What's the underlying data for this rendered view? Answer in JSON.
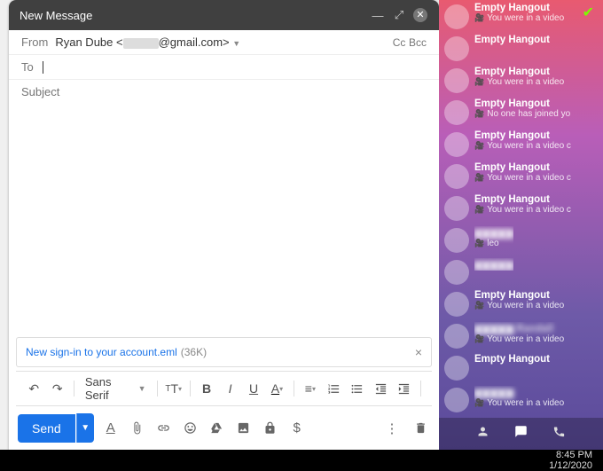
{
  "compose": {
    "title": "New Message",
    "from_label": "From",
    "from_name": "Ryan Dube <",
    "from_domain": "@gmail.com>",
    "cc": "Cc",
    "bcc": "Bcc",
    "to_label": "To",
    "subject_placeholder": "Subject",
    "attachment": {
      "name": "New sign-in to your account.eml",
      "size": "(36K)"
    },
    "font": "Sans Serif",
    "send": "Send"
  },
  "hangouts": {
    "items": [
      {
        "name": "Empty Hangout",
        "sub": "You were in a video",
        "blur": false
      },
      {
        "name": "Empty Hangout",
        "sub": "",
        "blur": false
      },
      {
        "name": "Empty Hangout",
        "sub": "You were in a video",
        "blur": false
      },
      {
        "name": "Empty Hangout",
        "sub": "No one has joined yo",
        "blur": false
      },
      {
        "name": "Empty Hangout",
        "sub": "You were in a video c",
        "blur": false
      },
      {
        "name": "Empty Hangout",
        "sub": "You were in a video c",
        "blur": false
      },
      {
        "name": "Empty Hangout",
        "sub": "You were in a video c",
        "blur": false
      },
      {
        "name": "hidden",
        "sub": "leo",
        "blur": true
      },
      {
        "name": "hidden",
        "sub": "",
        "blur": true
      },
      {
        "name": "Empty Hangout",
        "sub": "You were in a video",
        "blur": false
      },
      {
        "name": "hidden Randall",
        "sub": "You were in a video",
        "blur": true
      },
      {
        "name": "Empty Hangout",
        "sub": "",
        "blur": false
      },
      {
        "name": "hidden",
        "sub": "You were in a video",
        "blur": true
      }
    ]
  },
  "clock": {
    "time": "8:45 PM",
    "date": "1/12/2020"
  }
}
